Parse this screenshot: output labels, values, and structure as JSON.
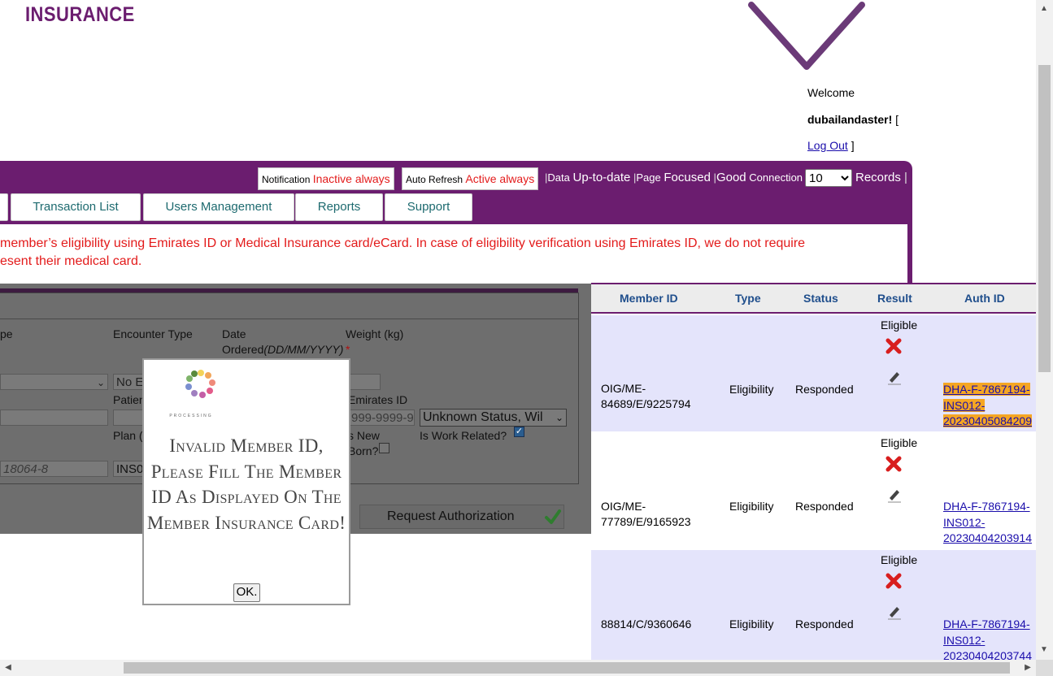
{
  "brand": {
    "logo_text": "INSURANCE"
  },
  "user": {
    "welcome": "Welcome",
    "username": "dubailandaster!",
    "bracket_open": " [",
    "logout": "Log Out",
    "bracket_close": " ]"
  },
  "status_bar": {
    "notification_label": "Notification",
    "notification_value": "Inactive always",
    "auto_refresh_label": "Auto Refresh",
    "auto_refresh_value": "Active always",
    "data_label": "Data",
    "data_value": "Up-to-date",
    "page_label": "Page",
    "page_value": "Focused",
    "connection_value": "Good",
    "connection_label": "Connection",
    "records_selected": "10",
    "records_label": "Records"
  },
  "nav": {
    "tabs": [
      "Transaction List",
      "Users Management",
      "Reports",
      "Support"
    ]
  },
  "notice": {
    "line1": "member’s eligibility using Emirates ID or Medical Insurance card/eCard. In case of eligibility verification using Emirates ID, we do not require",
    "line2": "esent their medical card."
  },
  "form": {
    "type_label": "pe",
    "encounter_type_label": "Encounter Type",
    "date_ordered_label": "Date",
    "date_ordered_label2": "Ordered",
    "date_format": "(DD/MM/YYYY)",
    "weight_label": "Weight (kg)",
    "required_star": "*",
    "encounter_value": "No E",
    "patient_label": "Patien",
    "emirates_id_label": "Emirates ID",
    "emirates_id_placeholder": "999-9999-9",
    "unknown_status_value": "Unknown Status, Wil",
    "plan_label": "Plan (",
    "is_new_born_label1": "s New",
    "is_new_born_label2": "Born?",
    "is_work_related_label": "Is Work Related?",
    "member_id_placeholder": "18064-8",
    "ins_value": "INS0",
    "request_authorization": "Request Authorization"
  },
  "modal": {
    "processing_label": "PROCESSING",
    "message": "Invalid Member ID, Please Fill The Member ID As Displayed On The Member Insurance Card!",
    "ok_button": "OK."
  },
  "table": {
    "headers": [
      "Member ID",
      "Type",
      "Status",
      "Result",
      "Auth ID"
    ],
    "rows": [
      {
        "member_id_1": "OIG/ME-",
        "member_id_2": "84689/E/9225794",
        "type": "Eligibility",
        "status": "Responded",
        "result": "Eligible",
        "auth_1": "DHA-F-7867194-",
        "auth_2": "INS012-",
        "auth_3": "20230405084209"
      },
      {
        "member_id_1": "OIG/ME-",
        "member_id_2": "77789/E/9165923",
        "type": "Eligibility",
        "status": "Responded",
        "result": "Eligible",
        "auth_1": "DHA-F-7867194-",
        "auth_2": "INS012-",
        "auth_3": "20230404203914"
      },
      {
        "member_id_1": "88814/C/9360646",
        "member_id_2": "",
        "type": "Eligibility",
        "status": "Responded",
        "result": "Eligible",
        "auth_1": "DHA-F-7867194-",
        "auth_2": "INS012-",
        "auth_3": "20230404203744"
      }
    ]
  },
  "colors": {
    "brand_purple": "#6b1d6f",
    "alert_red": "#e31b1b",
    "highlight_orange": "#f5a623",
    "header_blue": "#1f4e8c"
  }
}
